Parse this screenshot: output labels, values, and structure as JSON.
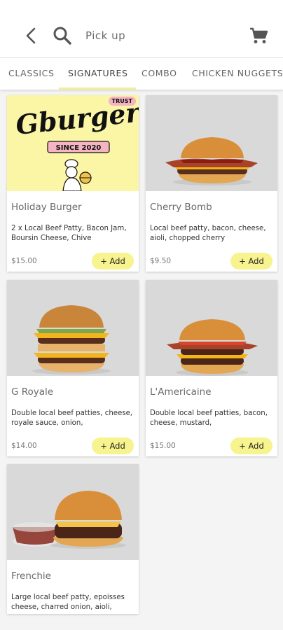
{
  "header": {
    "pickup_label": "Pick up"
  },
  "tabs": [
    {
      "label": "CLASSICS"
    },
    {
      "label": "SIGNATURES"
    },
    {
      "label": "COMBO"
    },
    {
      "label": "CHICKEN NUGGETS"
    }
  ],
  "active_tab": "SIGNATURES",
  "colors": {
    "accent": "#f7f38e",
    "underline": "#f2ef9a",
    "logo_bg": "#fbf6a6"
  },
  "logo": {
    "brand": "Gburger",
    "since": "SINCE 2020",
    "badge": "TRUST"
  },
  "products": [
    {
      "name": "Holiday Burger",
      "desc": "2 x Local Beef Patty, Bacon Jam, Boursin Cheese, Chive",
      "price": "$15.00",
      "add_label": "+ Add"
    },
    {
      "name": "Cherry Bomb",
      "desc": "Local beef patty, bacon, cheese, aioli, chopped cherry",
      "price": "$9.50",
      "add_label": "+ Add"
    },
    {
      "name": "G Royale",
      "desc": "Double local beef patties, cheese, royale sauce, onion,",
      "price": "$14.00",
      "add_label": "+ Add"
    },
    {
      "name": "L'Americaine",
      "desc": "Double local beef patties, bacon, cheese, mustard,",
      "price": "$15.00",
      "add_label": "+ Add"
    },
    {
      "name": "Frenchie",
      "desc": "Large local beef patty, epoisses cheese, charred onion, aioli,",
      "price": "",
      "add_label": ""
    }
  ]
}
